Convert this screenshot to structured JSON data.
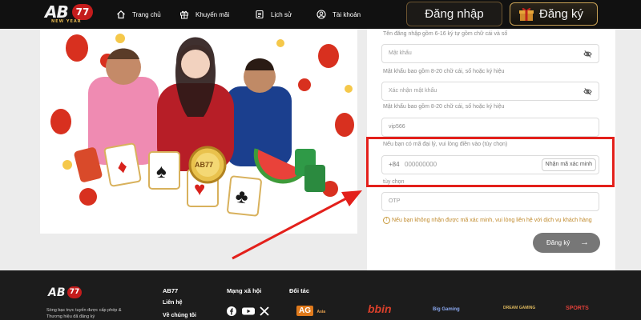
{
  "header": {
    "logo_text": "AB",
    "logo_badge": "77",
    "logo_sub": "NEW YEAR",
    "nav": [
      {
        "label": "Trang chủ",
        "icon": "home-icon"
      },
      {
        "label": "Khuyến mãi",
        "icon": "gift-icon"
      },
      {
        "label": "Lịch sử",
        "icon": "history-icon"
      },
      {
        "label": "Tài khoản",
        "icon": "user-icon"
      }
    ],
    "login_label": "Đăng nhập",
    "register_label": "Đăng ký"
  },
  "form": {
    "username_hint": "Tên đăng nhập gồm 6-16 ký tự gồm chữ cái và số",
    "password_placeholder": "Mật khẩu",
    "password_hint": "Mật khẩu bao gồm 8-20 chữ cái, số hoặc ký hiệu",
    "confirm_placeholder": "Xác nhận mật khẩu",
    "confirm_hint": "Mật khẩu bao gồm 8-20 chữ cái, số hoặc ký hiệu",
    "agent_value": "vip566",
    "agent_hint": "Nếu bạn có mã đại lý, vui lòng điền vào (tùy chọn)",
    "phone_prefix": "+84",
    "phone_placeholder": "000000000",
    "get_code_label": "Nhận mã xác minh",
    "optional_label": "tùy chọn",
    "otp_placeholder": "OTP",
    "info_text": "Nếu bạn không nhận được mã xác minh, vui lòng liên hệ với dịch vụ khách hàng",
    "submit_label": "Đăng ký",
    "submit_arrow": "→"
  },
  "banner": {
    "card_labels": [
      "♦",
      "♠",
      "♥",
      "♣"
    ],
    "chip_text": "AB77"
  },
  "footer": {
    "logo_text": "AB",
    "logo_badge": "77",
    "desc": "Sòng bạc trực tuyến được cấp phép & Thương hiệu đã đăng ký",
    "col1_head": "AB77",
    "col1_links": [
      "Liên hệ",
      "Về chúng tôi"
    ],
    "social_head": "Mạng xã hội",
    "partner_head": "Đối tác",
    "partners": [
      "AG",
      "Asia Gaming",
      "bbin",
      "Big Gaming",
      "DREAM GAMING",
      "SPORTS"
    ]
  },
  "colors": {
    "accent_red": "#e3201b",
    "gold": "#c9a255",
    "submit_bg": "#777777"
  }
}
